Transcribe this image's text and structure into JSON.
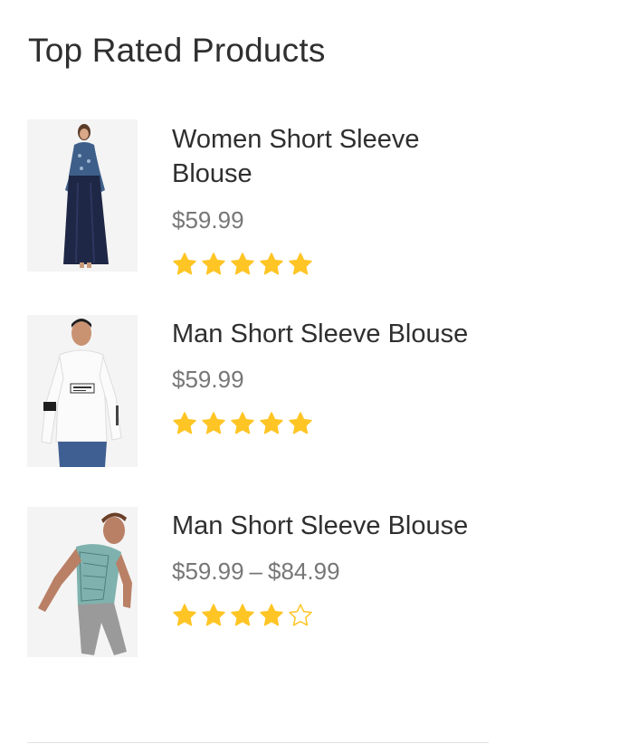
{
  "widget": {
    "title": "Top Rated Products"
  },
  "colors": {
    "star_filled": "#FFC525",
    "star_empty_stroke": "#FFC525",
    "price_text": "#777777",
    "title_text": "#2F2F2F"
  },
  "products": [
    {
      "name": "Women Short Sleeve Blouse",
      "price": "$59.99",
      "price_max": "",
      "rating": 5,
      "image": "woman-dress-photo"
    },
    {
      "name": "Man Short Sleeve Blouse",
      "price": "$59.99",
      "price_max": "",
      "rating": 5,
      "image": "man-white-shirt-photo"
    },
    {
      "name": "Man Short Sleeve Blouse",
      "price": "$59.99",
      "price_separator": "–",
      "price_max": "$84.99",
      "rating": 4,
      "image": "man-green-shirt-photo"
    }
  ]
}
